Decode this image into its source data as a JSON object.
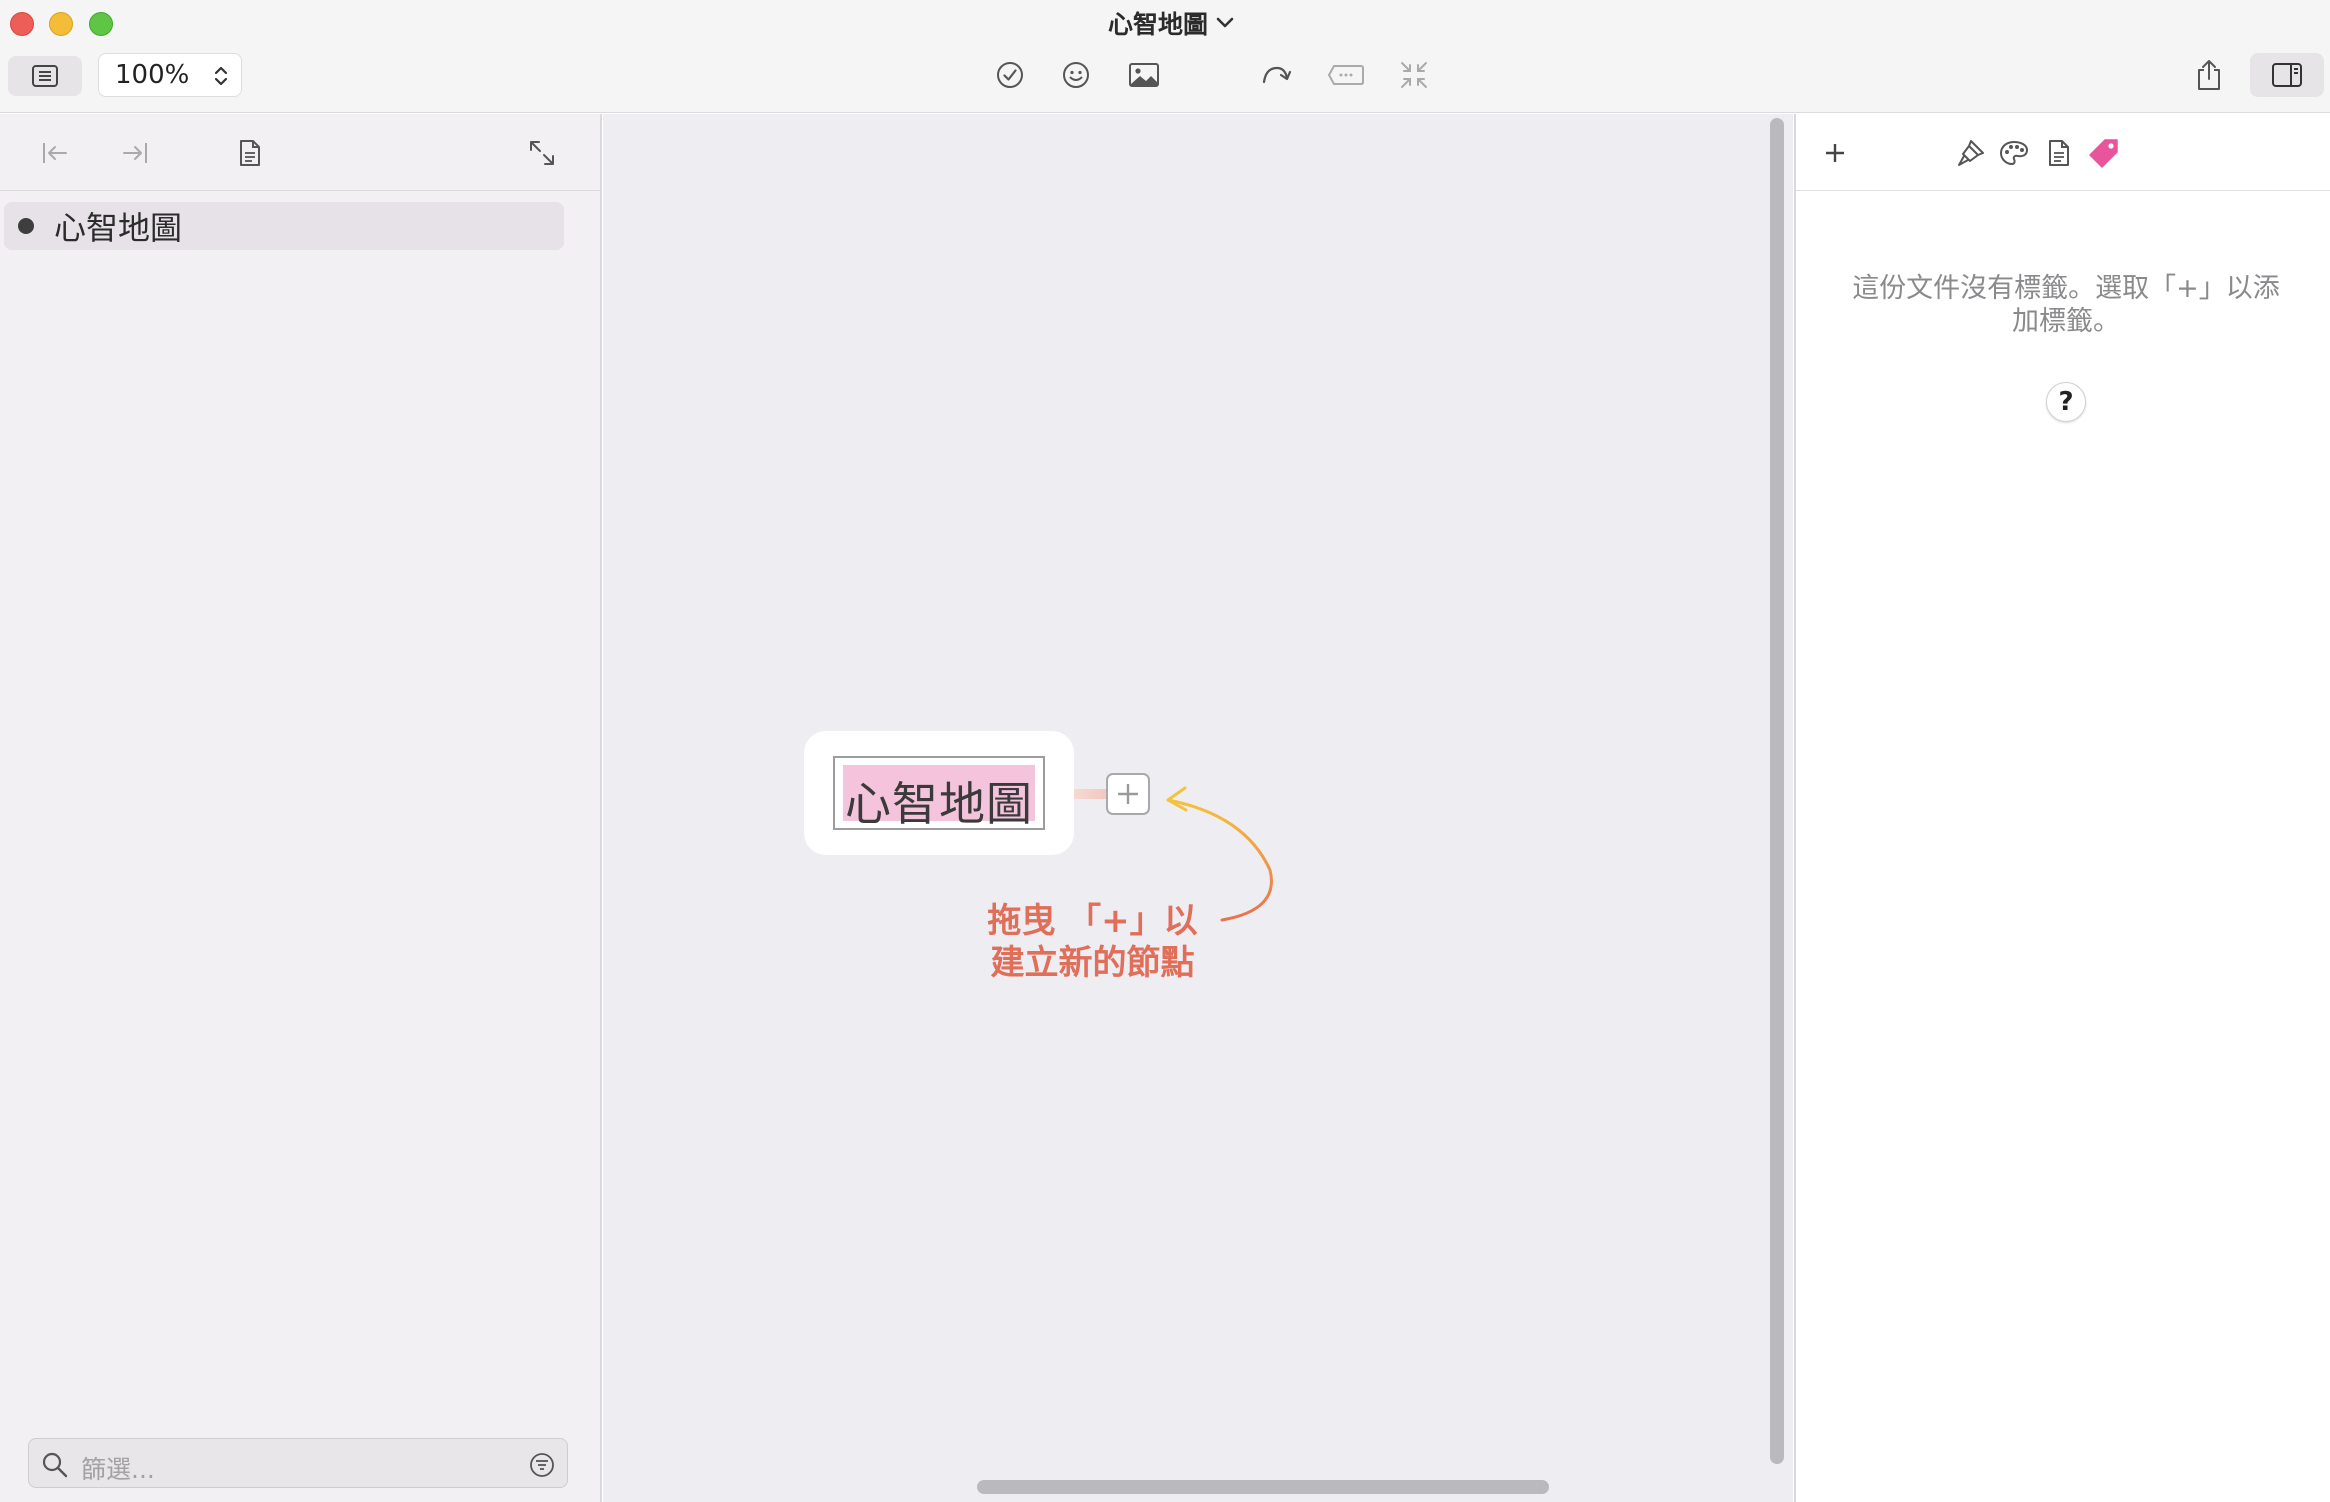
{
  "window": {
    "title": "心智地圖"
  },
  "toolbar": {
    "zoom_value": "100%",
    "icons": [
      "outline-view-icon",
      "checkmark-circle-icon",
      "smiley-icon",
      "image-icon",
      "redo-arrow-icon",
      "callout-icon",
      "collapse-icon",
      "share-icon",
      "sidebar-panel-icon"
    ]
  },
  "sidebar": {
    "toolbar_icons": [
      "outdent-icon",
      "indent-icon",
      "document-icon",
      "expand-icon"
    ],
    "outline_items": [
      {
        "label": "心智地圖"
      }
    ],
    "filter_placeholder": "篩選..."
  },
  "canvas": {
    "root_node_label": "心智地圖",
    "hint_lines": [
      "拖曳 「+」以",
      "建立新的節點"
    ],
    "hint_color": "#e06e58",
    "node_highlight_color": "#f4c3dc"
  },
  "inspector": {
    "toolbar_icons": [
      "plus-icon",
      "brush-icon",
      "palette-icon",
      "document-icon",
      "tag-icon"
    ],
    "active_tab": "tag-icon",
    "active_color": "#e8559c",
    "empty_message": "這份文件沒有標籤。選取「+」以添加標籤。",
    "help_label": "?"
  }
}
